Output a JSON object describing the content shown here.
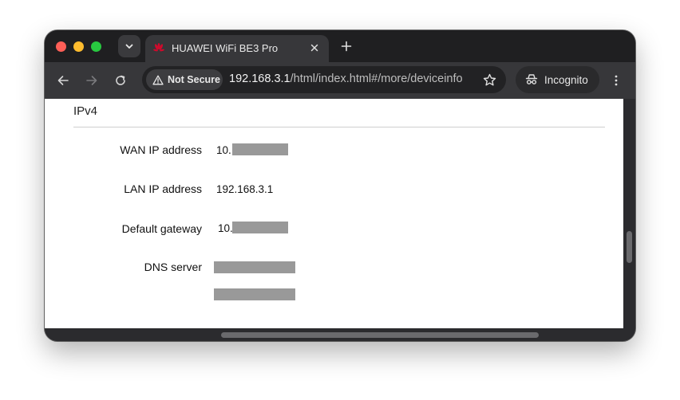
{
  "browser": {
    "tab": {
      "title": "HUAWEI WiFi BE3 Pro",
      "favicon": "huawei-logo-icon"
    },
    "security_chip": "Not Secure",
    "url_host": "192.168.3.1",
    "url_path": "/html/index.html#/more/deviceinfo",
    "profile_label": "Incognito",
    "icons": [
      "chevron-down-icon",
      "close-icon",
      "plus-icon",
      "back-arrow-icon",
      "forward-arrow-icon",
      "reload-icon",
      "warning-icon",
      "star-icon",
      "incognito-icon",
      "more-vert-icon"
    ]
  },
  "page": {
    "section_title": "IPv4",
    "rows": [
      {
        "label": "WAN IP address",
        "value": "10.",
        "redacted": true
      },
      {
        "label": "LAN IP address",
        "value": "192.168.3.1",
        "redacted": false
      },
      {
        "label": "Default gateway",
        "value": "10.",
        "redacted": true
      },
      {
        "label": "DNS server",
        "value": "",
        "redacted": true
      }
    ]
  },
  "colors": {
    "traffic_close": "#ff5f57",
    "traffic_min": "#febc2e",
    "traffic_max": "#28c840",
    "huawei_red": "#cf0a2c",
    "redaction_gray": "#999999"
  }
}
